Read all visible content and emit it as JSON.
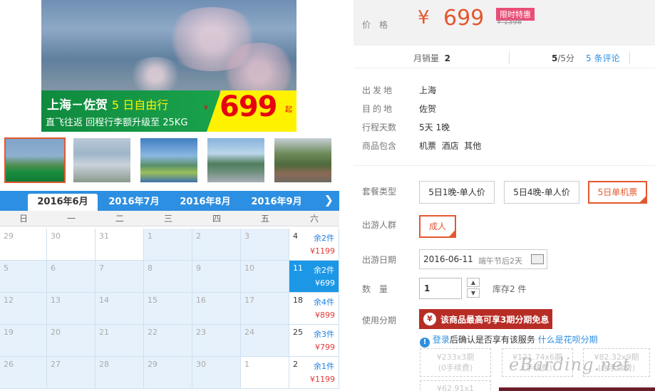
{
  "hero": {
    "title": "上海－佐贺",
    "title_suffix": "5 日自由行",
    "subtitle": "直飞往返 回程行李额升级至 25KG",
    "currency": "¥",
    "price": "699",
    "price_suffix": "起"
  },
  "calendar": {
    "months": [
      "2016年6月",
      "2016年7月",
      "2016年8月",
      "2016年9月"
    ],
    "next_icon": "chevron-right-icon",
    "weekdays": [
      "日",
      "一",
      "二",
      "三",
      "四",
      "五",
      "六"
    ],
    "weeks": [
      [
        "29",
        "30",
        "31",
        "1",
        "2",
        "3",
        "4"
      ],
      [
        "5",
        "6",
        "7",
        "8",
        "9",
        "10",
        "11"
      ],
      [
        "12",
        "13",
        "14",
        "15",
        "16",
        "17",
        "18"
      ],
      [
        "19",
        "20",
        "21",
        "22",
        "23",
        "24",
        "25"
      ],
      [
        "26",
        "27",
        "28",
        "29",
        "30",
        "1",
        "2"
      ]
    ],
    "availability": [
      {
        "remaining": "余2件",
        "price": "¥1199"
      },
      {
        "remaining": "余2件",
        "price": "¥699"
      },
      {
        "remaining": "余4件",
        "price": "¥899"
      },
      {
        "remaining": "余3件",
        "price": "¥799"
      },
      {
        "remaining": "余1件",
        "price": "¥1199"
      }
    ]
  },
  "price_box": {
    "label": "价格",
    "currency": "¥",
    "price": "699",
    "badge": "限时特惠",
    "old_price": "¥ 1398"
  },
  "stats": {
    "monthly_sales_label": "月销量",
    "monthly_sales": "2",
    "rating": "5",
    "rating_max": "/5分",
    "reviews": "5 条评论"
  },
  "info": [
    {
      "key": "出发地",
      "value": "上海"
    },
    {
      "key": "目的地",
      "value": "佐贺"
    },
    {
      "key": "行程天数",
      "value": "5天 1晚"
    },
    {
      "key": "商品包含",
      "value": "机票  酒店  其他"
    }
  ],
  "package": {
    "label": "套餐类型",
    "options": [
      "5日1晚-单人价",
      "5日4晚-单人价",
      "5日单机票"
    ]
  },
  "traveler": {
    "label": "出游人群",
    "option": "成人"
  },
  "date": {
    "label": "出游日期",
    "value": "2016-06-11",
    "note": "端午节后2天"
  },
  "quantity": {
    "label": "数量",
    "value": "1",
    "up": "▲",
    "down": "▼",
    "stock": "库存2 件"
  },
  "installment": {
    "label": "使用分期",
    "banner": "该商品最高可享3期分期免息",
    "banner_icon": "¥",
    "login_icon": "!",
    "login_link": "登录",
    "login_text": "后确认是否享有该服务 ",
    "login_q": "什么是花呗分期",
    "plans": [
      {
        "line1": "¥233x3期",
        "line2": "(0手续费)"
      },
      {
        "line1": "¥121.74x6期",
        "line2": "(手续费)"
      },
      {
        "line1": "¥82.32x9期",
        "line2": "(含手续费)"
      },
      {
        "line1": "¥62.91x1",
        "line2": ""
      }
    ]
  },
  "watermark": "eBarding.net",
  "colors": {
    "accent": "#e4572e",
    "calendar_blue": "#2d8fe1",
    "selected_day": "#1c97e6",
    "price_red": "#e4393c",
    "installment_red": "#b72d26"
  }
}
